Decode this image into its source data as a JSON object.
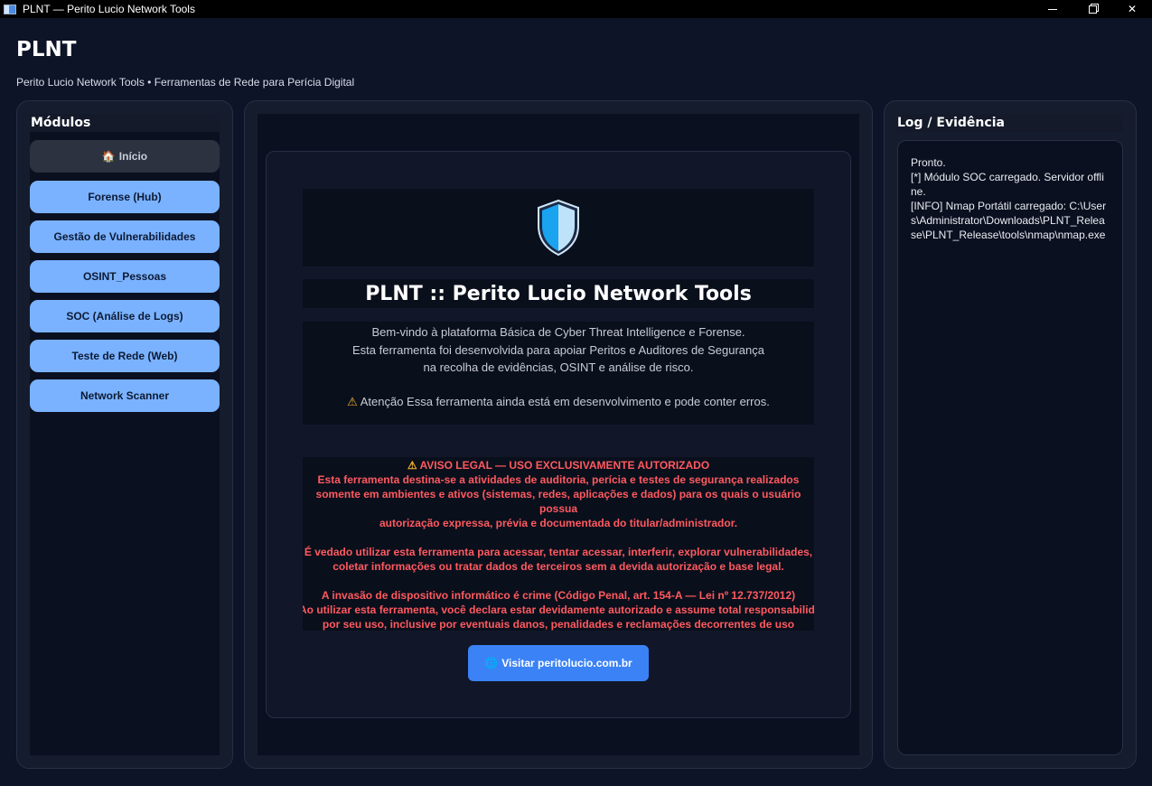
{
  "window": {
    "title": "PLNT — Perito Lucio Network Tools",
    "controls": {
      "minimize": "minimize-icon",
      "maximize": "maximize-icon",
      "close": "✕"
    }
  },
  "header": {
    "brand": "PLNT",
    "subtitle": "Perito Lucio Network Tools • Ferramentas de Rede para Perícia Digital"
  },
  "sidebar": {
    "heading": "Módulos",
    "items": [
      {
        "label": "Início",
        "icon": "🏠",
        "active": true
      },
      {
        "label": "Forense (Hub)"
      },
      {
        "label": "Gestão de Vulnerabilidades"
      },
      {
        "label": "OSINT_Pessoas"
      },
      {
        "label": "SOC (Análise de Logs)"
      },
      {
        "label": "Teste de Rede (Web)"
      },
      {
        "label": "Network Scanner"
      }
    ]
  },
  "main": {
    "icon": "shield-icon",
    "title": "PLNT :: Perito Lucio Network Tools",
    "welcome": [
      "Bem-vindo à plataforma Básica de Cyber Threat Intelligence e Forense.",
      "Esta ferramenta foi desenvolvida para apoiar Peritos e Auditores de Segurança",
      "na recolha de evidências, OSINT e análise de risco."
    ],
    "warning_icon": "⚠",
    "warning": "Atenção Essa ferramenta ainda está em desenvolvimento e pode conter erros.",
    "legal": {
      "icon": "⚠",
      "heading": "AVISO LEGAL — USO EXCLUSIVAMENTE AUTORIZADO",
      "p1": [
        "Esta ferramenta destina-se a atividades de auditoria, perícia e testes de segurança realizados",
        "somente em ambientes e ativos (sistemas, redes, aplicações e dados) para os quais o usuário possua",
        "autorização expressa, prévia e documentada do titular/administrador."
      ],
      "p2": [
        "É vedado utilizar esta ferramenta para acessar, tentar acessar, interferir, explorar vulnerabilidades,",
        "coletar informações ou tratar dados de terceiros sem a devida autorização e base legal."
      ],
      "p3": [
        "A invasão de dispositivo informático é crime (Código Penal, art. 154-A — Lei nº 12.737/2012)",
        "Ao utilizar esta ferramenta, você declara estar devidamente autorizado e assume total responsabilidade",
        "por seu uso, inclusive por eventuais danos, penalidades e reclamações decorrentes de uso indevido."
      ]
    },
    "visit_button": {
      "icon": "🌐",
      "label": "Visitar peritolucio.com.br"
    }
  },
  "log": {
    "heading": "Log / Evidência",
    "lines": [
      "Pronto.",
      "[*] Módulo SOC carregado. Servidor offline.",
      "[INFO] Nmap Portátil carregado: C:\\Users\\Administrator\\Downloads\\PLNT_Release\\PLNT_Release\\tools\\nmap\\nmap.exe"
    ]
  },
  "colors": {
    "background": "#0d1427",
    "nav_button": "#7ab2ff",
    "accent_button": "#3b82f6",
    "legal_text": "#ff5a5f",
    "warning": "#f3b328"
  }
}
